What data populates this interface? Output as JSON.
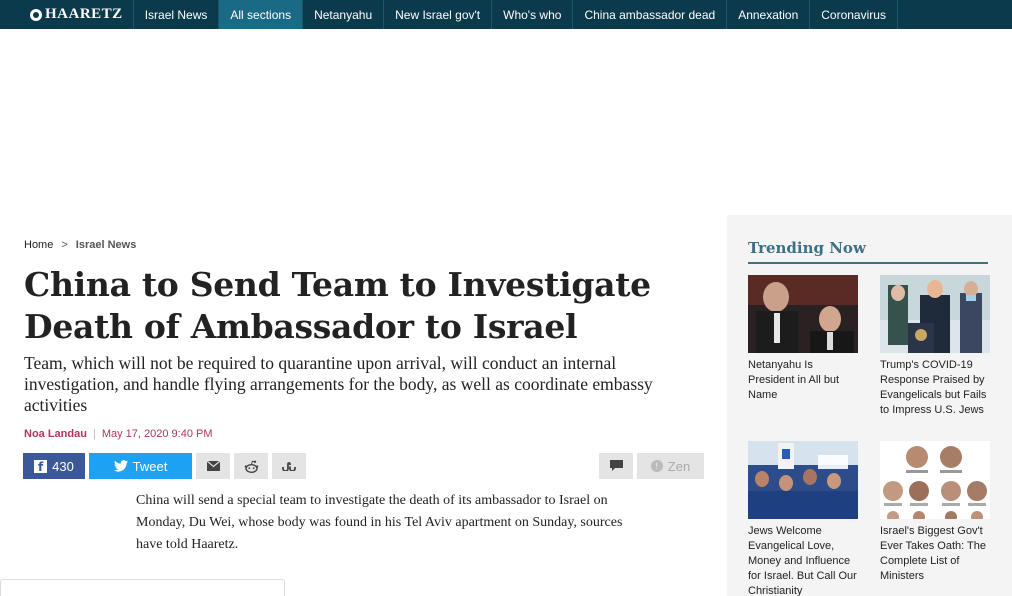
{
  "nav": {
    "logo": "HAARETZ",
    "items": [
      "Israel News",
      "All sections",
      "Netanyahu",
      "New Israel gov't",
      "Who's who",
      "China ambassador dead",
      "Annexation",
      "Coronavirus"
    ]
  },
  "breadcrumb": {
    "home": "Home",
    "sep": ">",
    "current": "Israel News"
  },
  "article": {
    "headline": "China to Send Team to Investigate Death of Ambassador to Israel",
    "subhead": "Team, which will not be required to quarantine upon arrival, will conduct an internal investigation, and handle flying arrangements for the body, as well as coordinate embassy activities",
    "author": "Noa Landau",
    "byline_sep": "|",
    "date": "May 17, 2020 9:40 PM",
    "body": "China will send a special team to investigate the death of its ambassador to Israel on Monday, Du Wei, whose body was found in his Tel Aviv apartment on Sunday, sources have told Haaretz."
  },
  "share": {
    "facebook_count": "430",
    "tweet_label": "Tweet",
    "zen_label": "Zen"
  },
  "trending": {
    "title": "Trending Now",
    "items": [
      {
        "caption": "Netanyahu Is President in All but Name"
      },
      {
        "caption": "Trump's COVID-19 Response Praised by Evangelicals but Fails to Impress U.S. Jews"
      },
      {
        "caption": "Jews Welcome Evangelical Love, Money and Influence for Israel. But Call Our Christianity"
      },
      {
        "caption": "Israel's Biggest Gov't Ever Takes Oath: The Complete List of Ministers"
      }
    ]
  },
  "colors": {
    "nav_bg": "#0b3a4d",
    "nav_active": "#1a6a85",
    "accent_byline": "#a8395b",
    "trending": "#3d6f85",
    "facebook": "#3b5998",
    "twitter": "#1da1f2"
  }
}
